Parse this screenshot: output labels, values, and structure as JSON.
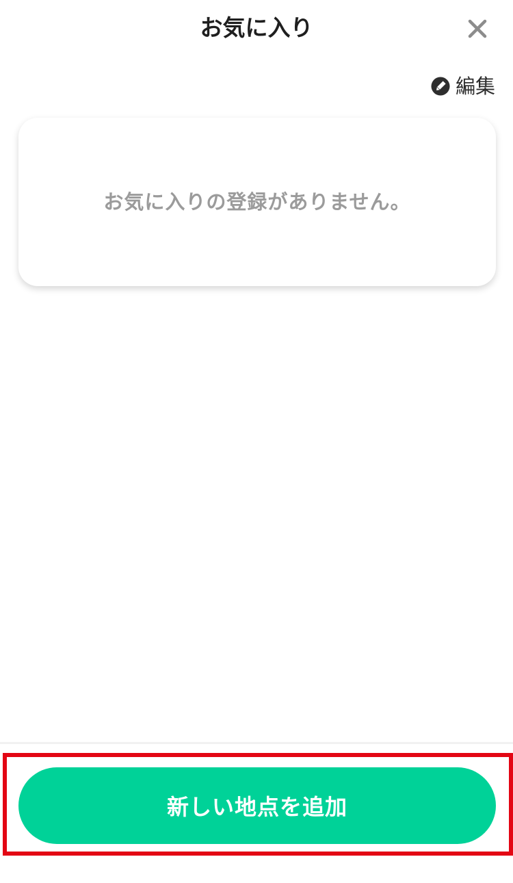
{
  "header": {
    "title": "お気に入り",
    "close_icon": "close-icon"
  },
  "toolbar": {
    "edit_label": "編集",
    "edit_icon": "pencil-icon"
  },
  "favorites": {
    "empty_message": "お気に入りの登録がありません。",
    "items": []
  },
  "footer": {
    "add_button_label": "新しい地点を追加"
  },
  "colors": {
    "accent_green": "#00d298",
    "highlight_red": "#e30614",
    "placeholder_gray": "#9b9b9b",
    "title_text": "#1f1f1f"
  }
}
